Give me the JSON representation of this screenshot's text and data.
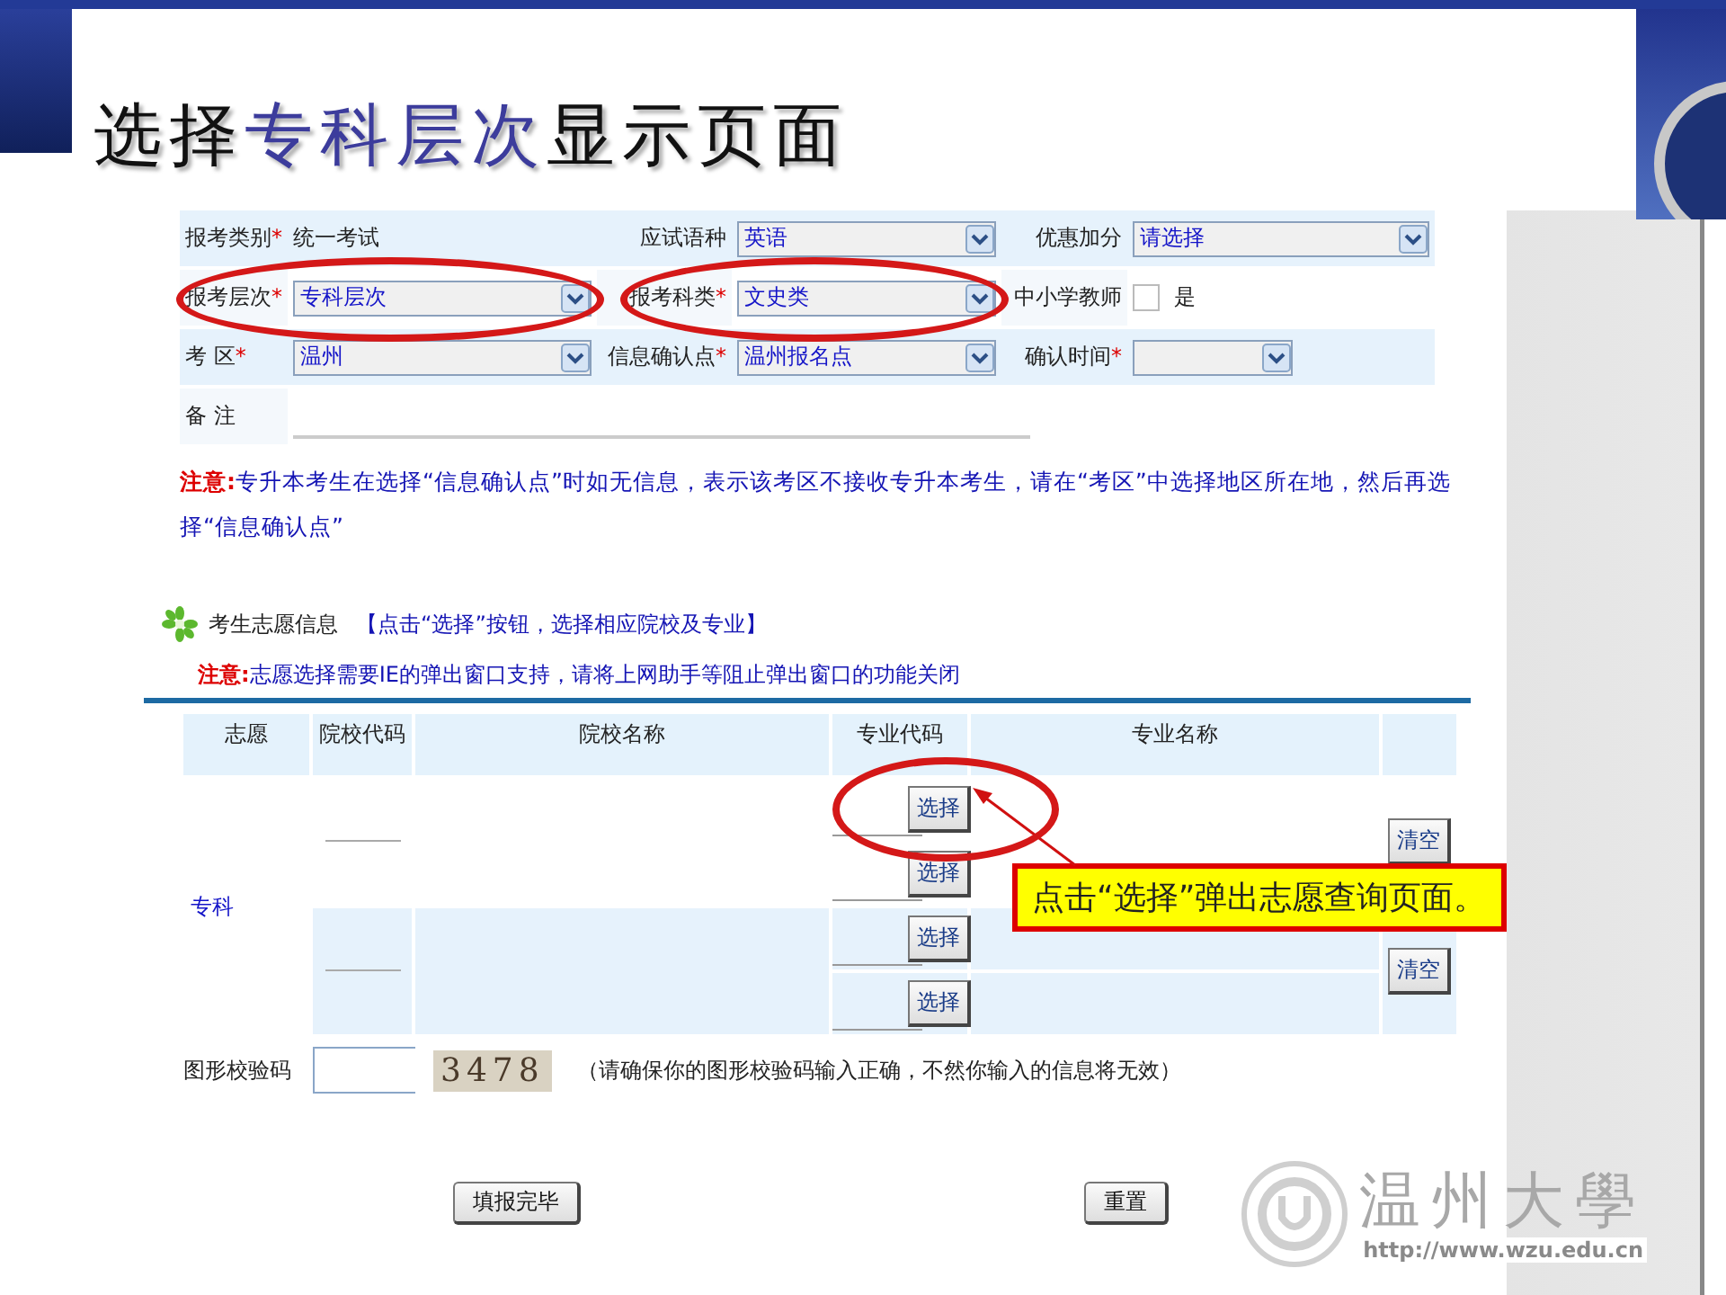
{
  "slide": {
    "title": [
      {
        "text": "选择",
        "highlight": false
      },
      {
        "text": "专科层次",
        "highlight": true
      },
      {
        "text": "显示页面",
        "highlight": false
      }
    ],
    "logo": {
      "name": "温州大學",
      "url": "http://www.wzu.edu.cn"
    }
  },
  "form": {
    "rows": [
      {
        "fields": [
          {
            "kind": "text",
            "label": "报考类别",
            "required_mark": "*",
            "value": "统一考试"
          },
          {
            "kind": "select",
            "label": "应试语种",
            "value": "英语"
          },
          {
            "kind": "select",
            "label": "优惠加分",
            "value": "请选择"
          }
        ]
      },
      {
        "fields": [
          {
            "kind": "select",
            "label": "报考层次",
            "required_mark": "*",
            "value": "专科层次",
            "circled": true
          },
          {
            "kind": "select",
            "label": "报考科类",
            "required_mark": "*",
            "value": "文史类",
            "circled": true
          },
          {
            "kind": "checkbox",
            "label": "中小学教师",
            "option": "是",
            "checked": false
          }
        ]
      },
      {
        "fields": [
          {
            "kind": "select",
            "label": "考 区",
            "required_mark": "*",
            "value": "温州"
          },
          {
            "kind": "select",
            "label": "信息确认点",
            "required_mark": "*",
            "value": "温州报名点"
          },
          {
            "kind": "select",
            "label": "确认时间",
            "required_mark": "*"
          }
        ]
      },
      {
        "fields": [
          {
            "kind": "textarea",
            "label": "备 注"
          }
        ]
      }
    ]
  },
  "notice1": {
    "label": "注意:",
    "text": "专升本考生在选择“信息确认点”时如无信息，表示该考区不接收专升本考生，请在“考区”中选择地区所在地，然后再选择“信息确认点”"
  },
  "volunteer": {
    "heading": "考生志愿信息",
    "hint": "【点击“选择”按钮，选择相应院校及专业】",
    "notice": {
      "label": "注意:",
      "text": "志愿选择需要IE的弹出窗口支持，请将上网助手等阻止弹出窗口的功能关闭"
    },
    "columns": [
      "志愿",
      "院校代码",
      "院校名称",
      "专业代码",
      "专业名称"
    ],
    "level": "专科",
    "groups": [
      {
        "majors": [
          {
            "button": "选择",
            "circled": true
          },
          {
            "button": "选择",
            "circled": false
          }
        ],
        "clear_button": "清空"
      },
      {
        "majors": [
          {
            "button": "选择",
            "circled": false
          },
          {
            "button": "选择",
            "circled": false
          }
        ],
        "clear_button": "清空"
      }
    ]
  },
  "captcha": {
    "label": "图形校验码",
    "code": "3478",
    "note": "（请确保你的图形校验码输入正确，不然你输入的信息将无效）"
  },
  "buttons": [
    "填报完毕",
    "重置"
  ],
  "callout": "点击“选择”弹出志愿查询页面。"
}
